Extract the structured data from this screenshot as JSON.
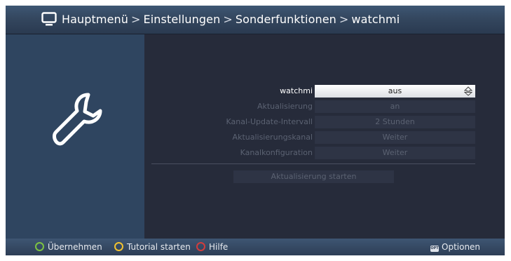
{
  "header": {
    "breadcrumb": [
      "Hauptmenü",
      "Einstellungen",
      "Sonderfunktionen",
      "watchmi"
    ],
    "separator": ">"
  },
  "icons": {
    "header": "tv-icon",
    "panel": "wrench-icon",
    "spinner": "up-down-arrow-icon"
  },
  "settings": [
    {
      "label": "watchmi",
      "value": "aus",
      "active": true
    },
    {
      "label": "Aktualisierung",
      "value": "an",
      "active": false
    },
    {
      "label": "Kanal-Update-Intervall",
      "value": "2 Stunden",
      "active": false
    },
    {
      "label": "Aktualisierungskanal",
      "value": "Weiter",
      "active": false
    },
    {
      "label": "Kanalkonfiguration",
      "value": "Weiter",
      "active": false
    }
  ],
  "start_button": "Aktualisierung starten",
  "footer": {
    "green": "Übernehmen",
    "yellow": "Tutorial starten",
    "red": "Hilfe",
    "options_badge": "OPT",
    "options": "Optionen"
  },
  "colors": {
    "green": "#7cc242",
    "yellow": "#f2c230",
    "red": "#d23c3c"
  }
}
